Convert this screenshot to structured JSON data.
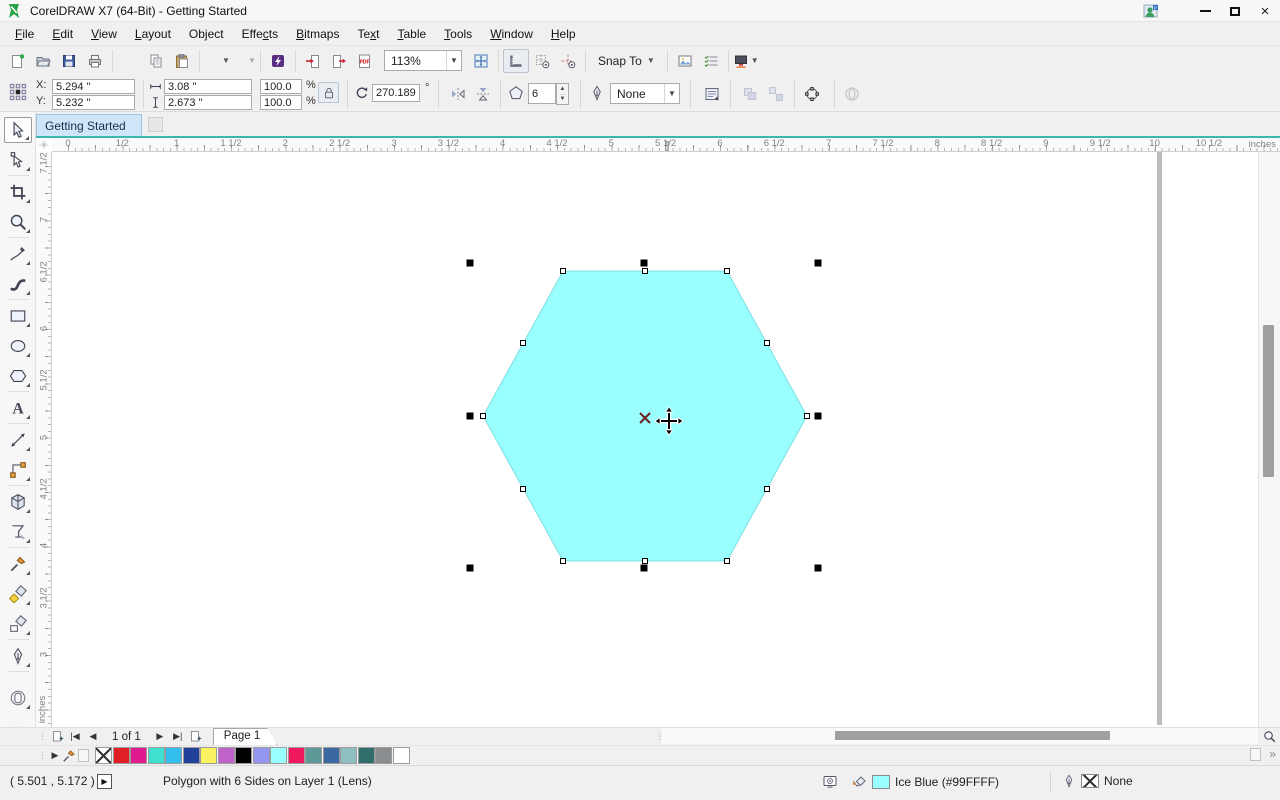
{
  "window": {
    "title": "CorelDRAW X7 (64-Bit) - Getting Started"
  },
  "titlebar_buttons": {
    "minimize": "minimize",
    "maximize": "maximize",
    "close": "close"
  },
  "menubar": {
    "items": [
      {
        "label": "File",
        "u": 0
      },
      {
        "label": "Edit",
        "u": 0
      },
      {
        "label": "View",
        "u": 0
      },
      {
        "label": "Layout",
        "u": 0
      },
      {
        "label": "Object",
        "u": -1
      },
      {
        "label": "Effects",
        "u": 4
      },
      {
        "label": "Bitmaps",
        "u": 0
      },
      {
        "label": "Text",
        "u": 2
      },
      {
        "label": "Table",
        "u": 0
      },
      {
        "label": "Tools",
        "u": 0
      },
      {
        "label": "Window",
        "u": 0
      },
      {
        "label": "Help",
        "u": 0
      }
    ]
  },
  "toolbar": {
    "zoom_level": "113%",
    "snap_to_label": "Snap To",
    "items": [
      {
        "t": "b",
        "n": "new-document-button",
        "i": "new"
      },
      {
        "t": "b",
        "n": "open-button",
        "i": "open"
      },
      {
        "t": "b",
        "n": "save-button",
        "i": "save"
      },
      {
        "t": "b",
        "n": "print-button",
        "i": "print"
      },
      {
        "t": "s"
      },
      {
        "t": "b",
        "n": "cut-button",
        "i": "cut"
      },
      {
        "t": "b",
        "n": "copy-button",
        "i": "copy"
      },
      {
        "t": "b",
        "n": "paste-button",
        "i": "paste"
      },
      {
        "t": "s"
      },
      {
        "t": "b",
        "n": "undo-button",
        "i": "undo",
        "dd": true
      },
      {
        "t": "b",
        "n": "redo-button",
        "i": "redo",
        "dd": true,
        "dis": true
      },
      {
        "t": "s"
      },
      {
        "t": "b",
        "n": "search-content-button",
        "i": "connect"
      },
      {
        "t": "s"
      },
      {
        "t": "b",
        "n": "import-button",
        "i": "import"
      },
      {
        "t": "b",
        "n": "export-button",
        "i": "export"
      },
      {
        "t": "b",
        "n": "publish-pdf-button",
        "i": "pdf"
      },
      {
        "t": "zoom"
      },
      {
        "t": "b",
        "n": "fullscreen-preview-button",
        "i": "fullscreen"
      },
      {
        "t": "s"
      },
      {
        "t": "b",
        "n": "show-rulers-button",
        "i": "rulers",
        "on": true
      },
      {
        "t": "b",
        "n": "show-grid-button",
        "i": "grid"
      },
      {
        "t": "b",
        "n": "show-guidelines-button",
        "i": "guidelines"
      },
      {
        "t": "s"
      },
      {
        "t": "snap"
      },
      {
        "t": "s"
      },
      {
        "t": "b",
        "n": "options-button",
        "i": "picture"
      },
      {
        "t": "b",
        "n": "customize-button",
        "i": "checklist"
      },
      {
        "t": "s"
      },
      {
        "t": "b",
        "n": "application-launcher-button",
        "i": "launcher",
        "dd": true
      }
    ]
  },
  "propbar": {
    "x_label": "X:",
    "y_label": "Y:",
    "x_value": "5.294 \"",
    "y_value": "5.232 \"",
    "width_value": "3.08 \"",
    "height_value": "2.673 \"",
    "scale_h": "100.0",
    "scale_v": "100.0",
    "percent": "%",
    "angle_value": "270.189",
    "degree": "°",
    "sides_value": "6",
    "outline_width_value": "None"
  },
  "doc_tab": {
    "label": "Getting Started"
  },
  "rulers": {
    "h_labels": [
      "0",
      "1/2",
      "1",
      "1 1/2",
      "2",
      "2 1/2",
      "3",
      "3 1/2",
      "4",
      "4 1/2",
      "5",
      "5 1/2",
      "6",
      "6 1/2",
      "7",
      "7 1/2",
      "8",
      "8 1/2",
      "9",
      "9 1/2",
      "10",
      "10 1/2"
    ],
    "v_labels": [
      "7 1/2",
      "7",
      "6 1/2",
      "6",
      "5 1/2",
      "5",
      "4 1/2",
      "4",
      "3 1/2",
      "3"
    ],
    "h_unit": "inches",
    "v_unit": "inches"
  },
  "toolbox": {
    "tools": [
      {
        "n": "pick-tool",
        "i": "pick",
        "sel": true,
        "fly": true
      },
      {
        "n": "shape-tool",
        "i": "shape",
        "fly": true
      },
      {
        "n": "crop-tool",
        "i": "crop",
        "fly": true
      },
      {
        "n": "zoom-tool",
        "i": "zoomt",
        "fly": true
      },
      {
        "n": "freehand-tool",
        "i": "freehand",
        "fly": true
      },
      {
        "n": "artistic-media-tool",
        "i": "artistic",
        "fly": true
      },
      {
        "n": "rectangle-tool",
        "i": "rectt",
        "fly": true
      },
      {
        "n": "ellipse-tool",
        "i": "ellipset",
        "fly": true
      },
      {
        "n": "polygon-tool",
        "i": "hexi",
        "fly": true
      },
      {
        "n": "text-tool",
        "i": "texti",
        "fly": true
      },
      {
        "n": "parallel-dimension-tool",
        "i": "dimension",
        "fly": true
      },
      {
        "n": "connector-tool",
        "i": "connector",
        "fly": true
      },
      {
        "n": "extrude-tool",
        "i": "cube",
        "fly": true
      },
      {
        "n": "transparency-tool",
        "i": "glass",
        "fly": true
      },
      {
        "n": "color-eyedropper-tool",
        "i": "dropper",
        "fly": true
      },
      {
        "n": "smart-fill-tool",
        "i": "smartfill",
        "fly": true
      },
      {
        "n": "fill-tool",
        "i": "fillbucket",
        "fly": true
      },
      {
        "n": "outline-pen-tool",
        "i": "nib",
        "fly": true
      },
      {
        "n": "interactive-fill-tool",
        "i": "openshape",
        "fly": true
      },
      {
        "n": "more-tools-button",
        "i": "more",
        "fly": false
      }
    ]
  },
  "object": {
    "fill_color": "#99FFFF"
  },
  "page_nav": {
    "page_indicator": "1 of 1",
    "page_tab": "Page 1"
  },
  "palette": {
    "swatches": [
      "none",
      "#E01E26",
      "#E01A8F",
      "#3FE0D0",
      "#33BEEF",
      "#20409A",
      "#FBF25F",
      "#BF63C9",
      "#000000",
      "#9595F2",
      "#99FFFF",
      "#F0195E",
      "#5F9898",
      "#3A68A2",
      "#8FBEC0",
      "#306E6B",
      "#8A8D8F",
      "#FFFFFF"
    ]
  },
  "statusbar": {
    "cursor_coords": "( 5.501 , 5.172 )",
    "object_info": "Polygon with 6 Sides on Layer 1 (Lens)",
    "fill_label": "Ice Blue (#99FFFF)",
    "fill_color": "#99FFFF",
    "outline_label": "None"
  },
  "accent": {
    "teal": "#3AB7AE"
  }
}
